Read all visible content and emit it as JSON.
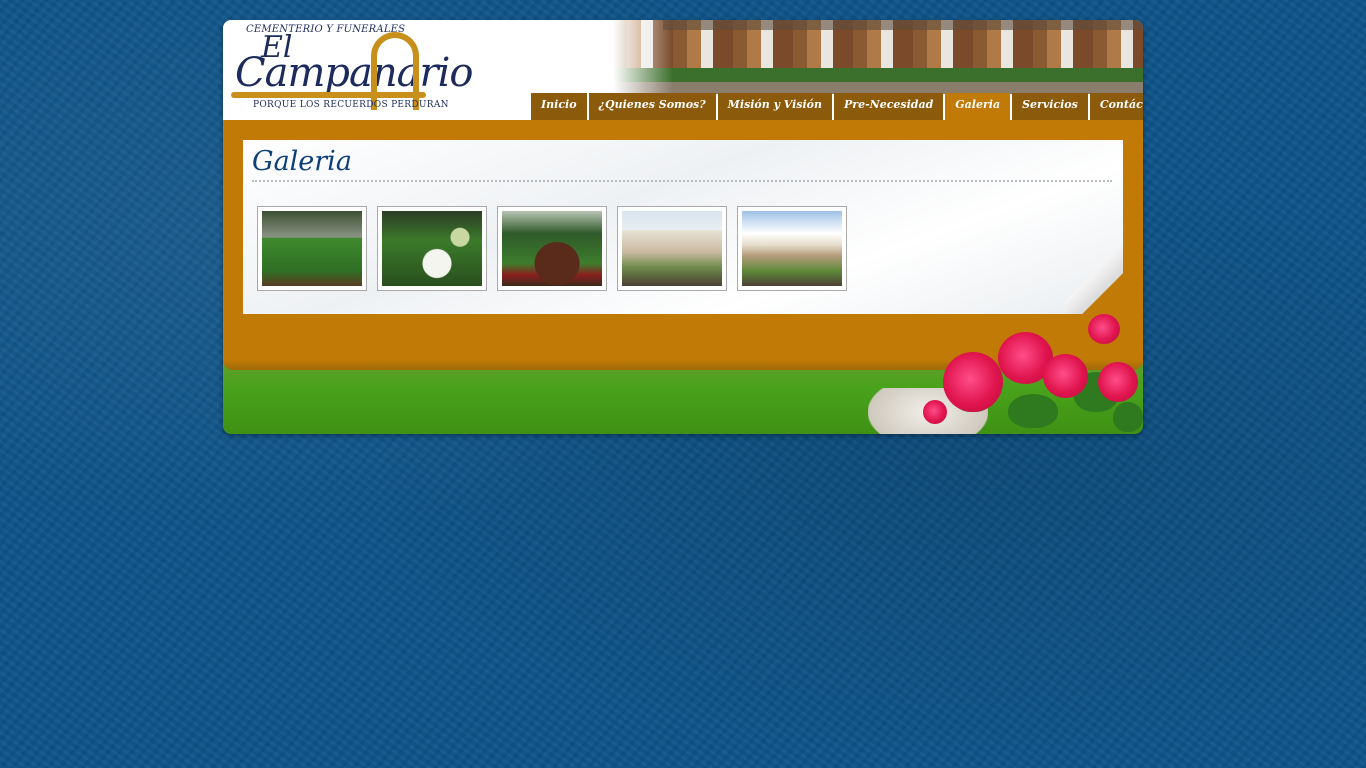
{
  "logo": {
    "top_text": "CEMENTERIO Y FUNERALES",
    "el": "El",
    "name": "Campanario",
    "tagline": "PORQUE LOS RECUERDOS PERDURAN"
  },
  "nav": {
    "items": [
      {
        "label": "Inicio"
      },
      {
        "label": "¿Quienes Somos?"
      },
      {
        "label": "Misión y Visión"
      },
      {
        "label": "Pre-Necesidad"
      },
      {
        "label": "Galeria"
      },
      {
        "label": "Servicios"
      },
      {
        "label": "Contáctenos"
      }
    ],
    "active": "Galeria"
  },
  "main": {
    "title": "Galeria",
    "thumbnails": [
      {
        "name": "gallery-thumb-1"
      },
      {
        "name": "gallery-thumb-2"
      },
      {
        "name": "gallery-thumb-3"
      },
      {
        "name": "gallery-thumb-4"
      },
      {
        "name": "gallery-thumb-5"
      }
    ]
  },
  "colors": {
    "background": "#0e5489",
    "accent": "#c07a05",
    "nav": "#8b5a0a",
    "title": "#0e3f78"
  }
}
